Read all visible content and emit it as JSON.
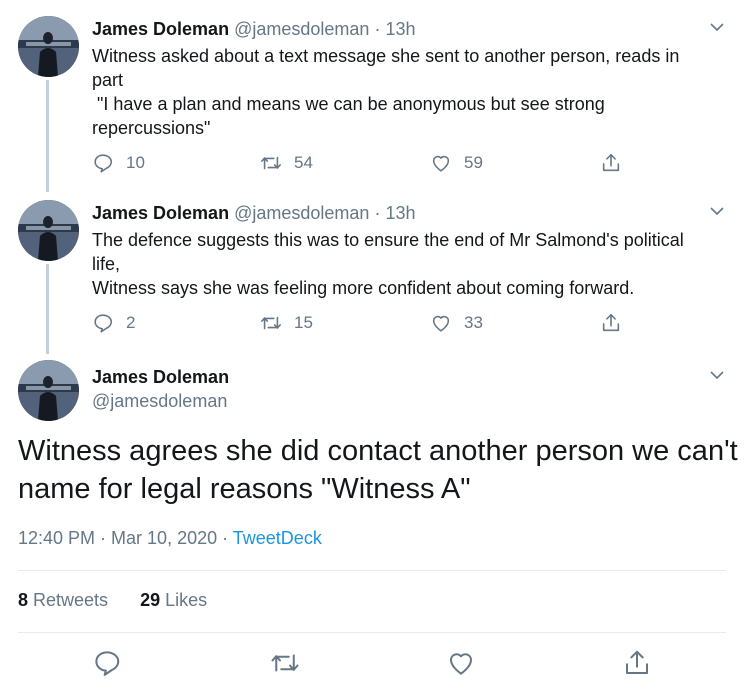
{
  "tweets": [
    {
      "name": "James Doleman",
      "handle": "@jamesdoleman",
      "time": "· 13h",
      "text": "Witness asked about a text message she sent to another person, reads in part\n \"I have a plan and means we can be anonymous but see strong repercussions\"",
      "replies": "10",
      "retweets": "54",
      "likes": "59"
    },
    {
      "name": "James Doleman",
      "handle": "@jamesdoleman",
      "time": "· 13h",
      "text": "The defence suggests this was to ensure the end of Mr Salmond's political life,\nWitness says she was feeling more confident about coming forward.",
      "replies": "2",
      "retweets": "15",
      "likes": "33"
    }
  ],
  "focus": {
    "name": "James Doleman",
    "handle": "@jamesdoleman",
    "text": "Witness agrees she did contact another person we can't name for legal reasons \"Witness A\"",
    "timestamp": "12:40 PM · Mar 10, 2020 · ",
    "source": "TweetDeck",
    "retweet_count": "8",
    "retweet_label": " Retweets",
    "like_count": "29",
    "like_label": " Likes"
  },
  "icons": {
    "reply": "reply-icon",
    "retweet": "retweet-icon",
    "like": "heart-icon",
    "share": "share-icon",
    "more": "chevron-down-icon"
  },
  "colors": {
    "text": "#14171a",
    "muted": "#657786",
    "link": "#1b95e0",
    "thread_line": "#c4cfd6"
  }
}
